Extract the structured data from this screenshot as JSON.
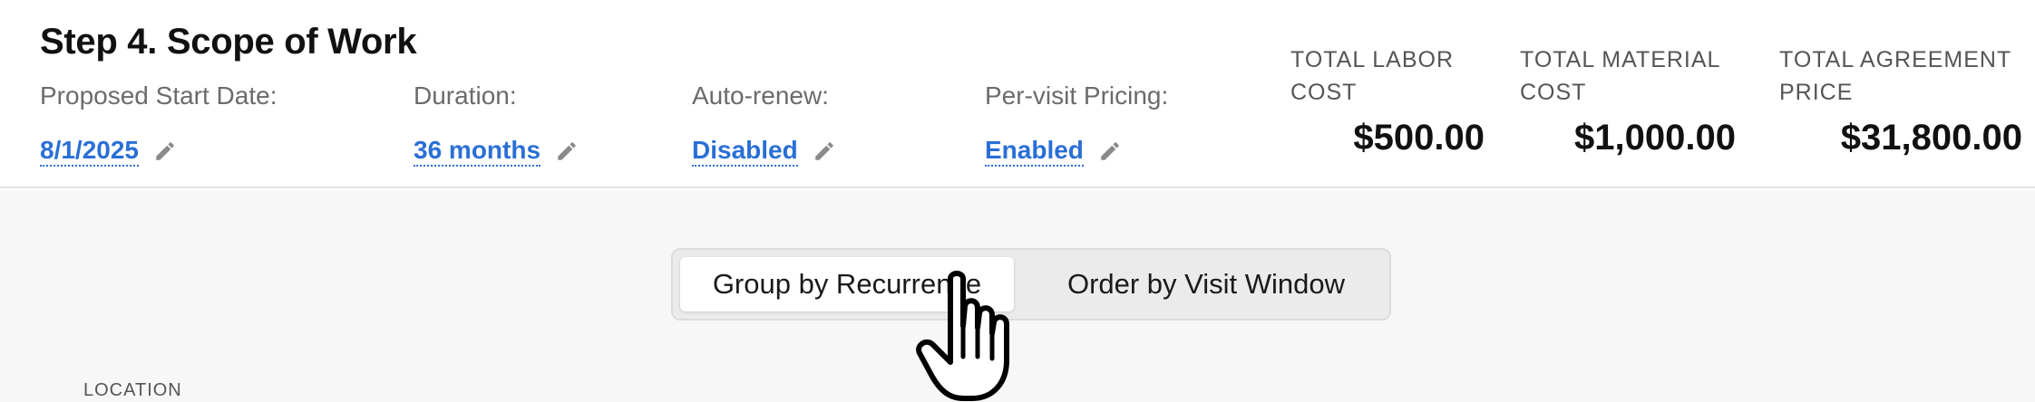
{
  "header": {
    "title": "Step 4. Scope of Work",
    "fields": [
      {
        "label": "Proposed Start Date:",
        "value": "8/1/2025",
        "icon": "pencil-icon"
      },
      {
        "label": "Duration:",
        "value": "36 months",
        "icon": "pencil-icon"
      },
      {
        "label": "Auto-renew:",
        "value": "Disabled",
        "icon": "pencil-icon"
      },
      {
        "label": "Per-visit Pricing:",
        "value": "Enabled",
        "icon": "pencil-icon"
      }
    ],
    "totals": [
      {
        "label_line1": "TOTAL LABOR",
        "label_line2": "COST",
        "value": "$500.00"
      },
      {
        "label_line1": "TOTAL MATERIAL",
        "label_line2": "COST",
        "value": "$1,000.00"
      },
      {
        "label_line1": "TOTAL AGREEMENT",
        "label_line2": "PRICE",
        "value": "$31,800.00"
      }
    ]
  },
  "view_toggle": {
    "options": [
      {
        "label": "Group by Recurrence",
        "selected": true
      },
      {
        "label": "Order by Visit Window",
        "selected": false
      }
    ]
  },
  "content": {
    "location_label": "LOCATION"
  },
  "colors": {
    "link": "#2a6fd6",
    "content_bg": "#f7f7f7",
    "toggle_bg": "#ebebeb"
  }
}
